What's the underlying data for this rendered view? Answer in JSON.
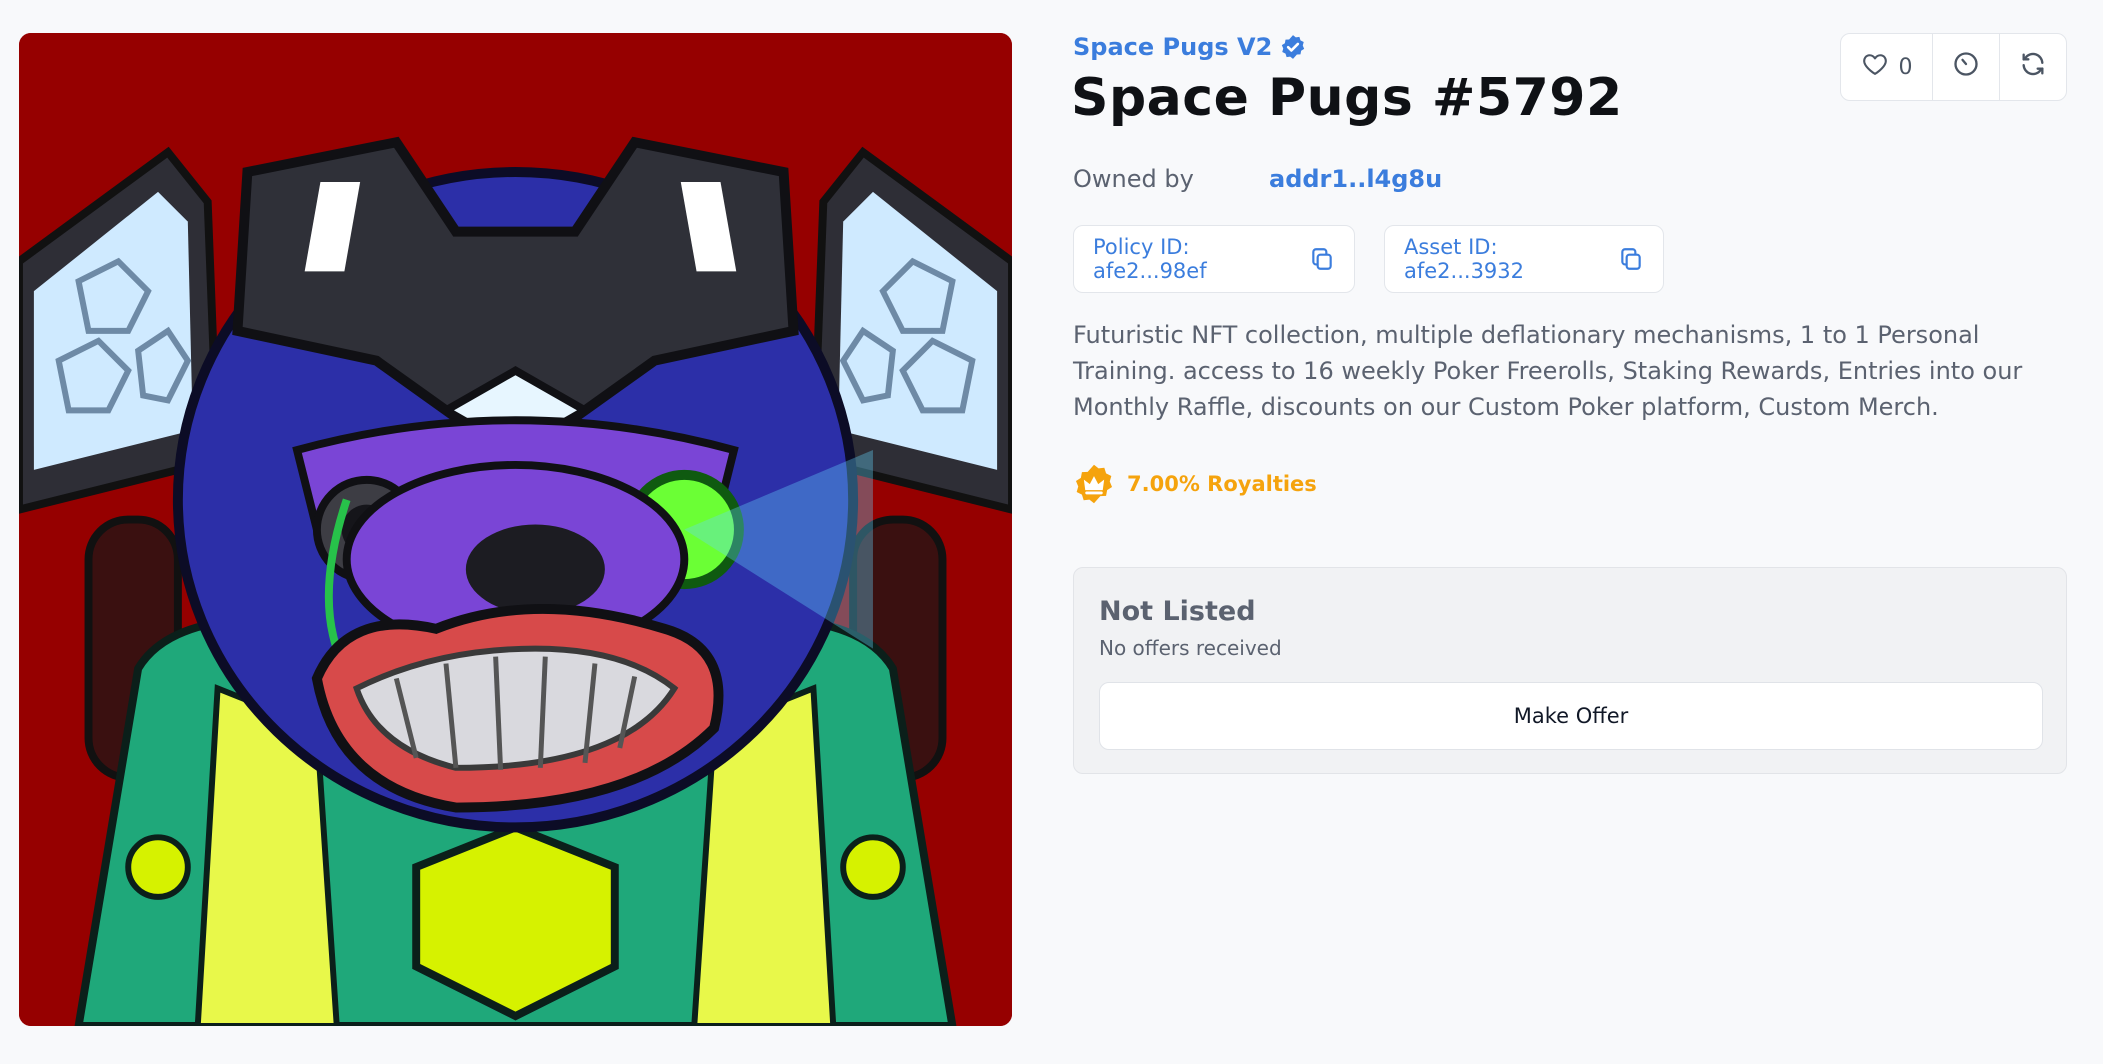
{
  "collection": {
    "name": "Space Pugs V2",
    "verified": true
  },
  "asset": {
    "title": "Space Pugs #5792",
    "image_alt": "Space Pugs #5792 artwork",
    "owner_label": "Owned by",
    "owner_address": "addr1..l4g8u",
    "policy_id": "Policy ID: afe2...98ef",
    "asset_id": "Asset ID: afe2...3932",
    "description": "Futuristic NFT collection, multiple deflationary mechanisms, 1 to 1 Personal Training. access to 16 weekly Poker Freerolls, Staking Rewards, Entries into our Monthly Raffle, discounts on our Custom Poker platform, Custom Merch.",
    "royalties": "7.00% Royalties"
  },
  "actions": {
    "like_count": "0",
    "icons": [
      "heart-icon",
      "history-icon",
      "refresh-icon"
    ]
  },
  "listing": {
    "status": "Not Listed",
    "offers_text": "No offers received",
    "make_offer_label": "Make Offer"
  },
  "colors": {
    "link": "#3b7ddd",
    "royalty": "#f5a30d",
    "background": "#f8f9fb"
  }
}
